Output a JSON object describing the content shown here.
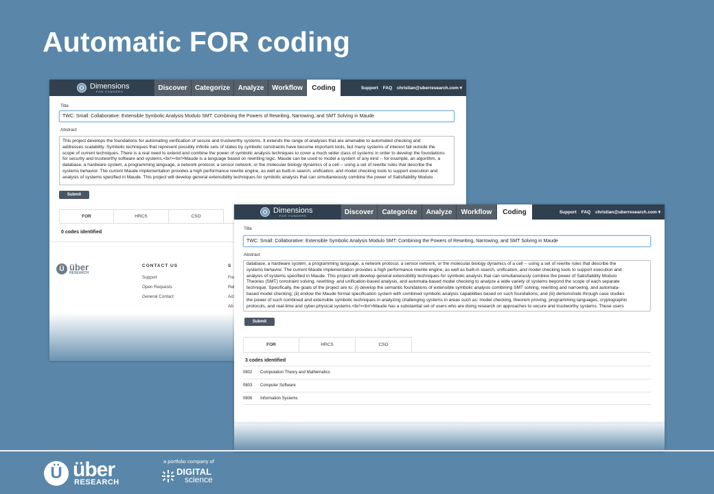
{
  "slide": {
    "title": "Automatic FOR coding"
  },
  "app": {
    "logo_name": "Dimensions",
    "logo_sub": "FOR FUNDERS",
    "nav": [
      "Discover",
      "Categorize",
      "Analyze",
      "Workflow",
      "Coding"
    ],
    "active_nav": "Coding",
    "support": "Support",
    "faq": "FAQ",
    "user": "christian@uberresearch.com ▾",
    "title_label": "Title",
    "abstract_label": "Abstract",
    "submit_label": "Submit",
    "subtabs": [
      "FOR",
      "HRCS",
      "CSO"
    ]
  },
  "window1": {
    "title_value": "TWC: Small: Collaborative: Extensible Symbolic Analysis Modulo SMT: Combining the Powers of Rewriting, Narrowing, and SMT Solving in Maude",
    "abstract_lines": [
      "This project develops the foundations for automating verification of secure and trustworthy systems. It extends the range of analyses that are amenable to automated checking and",
      "addresses scalability. Symbolic techniques that represent possibly infinite sets of states by symbolic constraints have become important tools, but many systems of interest fall outside the",
      "scope of current techniques. There is a real need to extend and combine the power of symbolic analysis techniques to cover a much wider class of systems in order to develop the foundations",
      "for security and trustworthy software and systems.<br/><br/>Maude is a language based on rewriting logic. Maude can be used to model a system of any kind -- for example, an algorithm, a",
      "database, a hardware system, a programming language, a network protocol, a sensor network, or the molecular biology dynamics of a cell -- using a set of rewrite rules that describe the",
      "systems behavior. The current Maude implementation provides a high performance rewrite engine, as well as built-in search, unification, and model checking tools to support execution and",
      "analysis of systems specified in Maude. This project will develop general extensibility techniques for symbolic analysis that can simultaneously combine the power of Satisfiability Modulo"
    ],
    "codes_identified": "0 codes identified",
    "footer": {
      "brand_big": "über",
      "brand_small": "RESEARCH",
      "contact_title": "CONTACT US",
      "contact_links": [
        "Support",
        "Open Requests",
        "General Contact"
      ],
      "col2_title": "S",
      "col2_links": [
        "Fre",
        "Rel",
        "Acl",
        "Ab"
      ]
    }
  },
  "window2": {
    "title_value": "TWC: Small: Collaborative: Extensible Symbolic Analysis Modulo SMT: Combining the Powers of Rewriting, Narrowing, and SMT Solving in Maude",
    "abstract_lines": [
      "database, a hardware system, a programming language, a network protocol, a sensor network, or the molecular biology dynamics of a cell -- using a set of rewrite rules that describe the",
      "systems behavior. The current Maude implementation provides a high performance rewrite engine, as well as built-in search, unification, and model checking tools to support execution and",
      "analysis of systems specified in Maude. This project will develop general extensibility techniques for symbolic analysis that can simultaneously combine the power of Satisfiability Modulo",
      "Theories (SMT) constraint solving, rewriting- and unification-based analysis, and automata-based model checking to analyze a wide variety of systems beyond the scope of each separate",
      "technique. Specifically, the goals of the project are to: (i) develop the semantic foundations of extensible symbolic analysis combining SMT solving, rewriting and narrowing, and automata-",
      "based model checking; (ii) endow the Maude formal specification system with combined symbolic analysis capabilities based on such foundations; and (iii) demonstrate through case studies",
      "the power of such combined and extensible symbolic techniques in analyzing challenging systems in areas such as: model checking, theorem proving, programming languages, cryptographic",
      "protocols, and real-time and cyber-physical systems.<br/><br/>Maude has a substantial set of users who are doing research on approaches to secure and trustworthy systems. These users"
    ],
    "codes_identified": "3 codes identified",
    "codes": [
      {
        "code": "0802",
        "name": "Computation Theory and Mathematics"
      },
      {
        "code": "0803",
        "name": "Computer Software"
      },
      {
        "code": "0806",
        "name": "Information Systems"
      }
    ]
  },
  "branding": {
    "uber_big": "über",
    "uber_small": "RESEARCH",
    "portfolio_text": "a portfolio company of",
    "digital_big": "DIGITAL",
    "digital_small": "science"
  },
  "colors": {
    "background": "#5a87a9",
    "topbar": "#31404f",
    "nav_tab": "#55606b",
    "submit": "#4a5663"
  }
}
